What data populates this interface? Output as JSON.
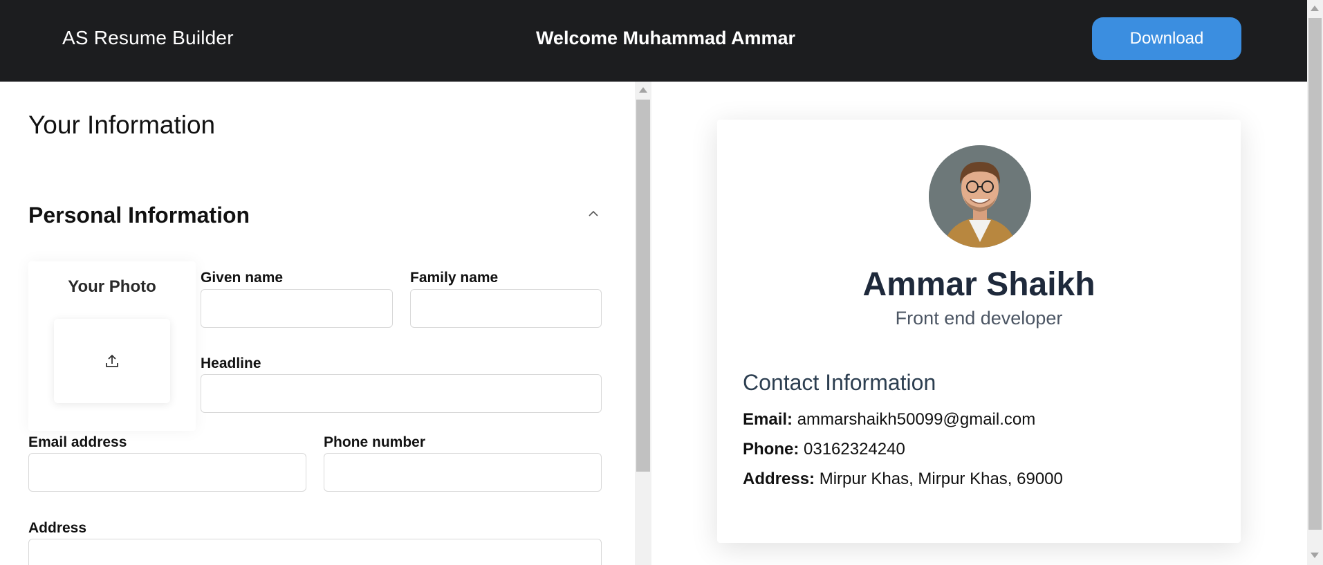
{
  "header": {
    "brand": "AS Resume Builder",
    "welcome": "Welcome Muhammad Ammar",
    "download_label": "Download"
  },
  "form": {
    "page_title": "Your Information",
    "section_title": "Personal Information",
    "photo_label": "Your Photo",
    "fields": {
      "given_name": {
        "label": "Given name",
        "value": ""
      },
      "family_name": {
        "label": "Family name",
        "value": ""
      },
      "headline": {
        "label": "Headline",
        "value": ""
      },
      "email": {
        "label": "Email address",
        "value": ""
      },
      "phone": {
        "label": "Phone number",
        "value": ""
      },
      "address": {
        "label": "Address",
        "value": ""
      }
    }
  },
  "preview": {
    "name": "Ammar Shaikh",
    "headline": "Front end developer",
    "contact_title": "Contact Information",
    "email_label": "Email:",
    "email_value": "ammarshaikh50099@gmail.com",
    "phone_label": "Phone:",
    "phone_value": "03162324240",
    "address_label": "Address:",
    "address_value": "Mirpur Khas, Mirpur Khas, 69000"
  },
  "icons": {
    "upload": "upload-icon",
    "collapse": "chevron-up-icon"
  },
  "colors": {
    "header_bg": "#1c1d1f",
    "accent": "#3b8ee0"
  }
}
